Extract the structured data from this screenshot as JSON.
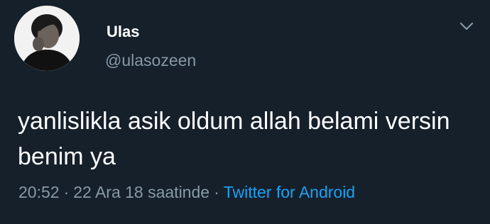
{
  "user": {
    "name": "Ulas",
    "handle": "@ulasozeen",
    "avatar_icon": "profile-photo"
  },
  "tweet": {
    "text": "yanlislikla asik oldum allah belami versin benim ya",
    "time": "20:52",
    "separator": "·",
    "date": "22 Ara 18 saatinde",
    "source": "Twitter for Android"
  },
  "menu": {
    "icon": "chevron-down-icon"
  },
  "colors": {
    "background": "#15202b",
    "text": "#ffffff",
    "secondary": "#8899a6",
    "link": "#1da1f2"
  }
}
